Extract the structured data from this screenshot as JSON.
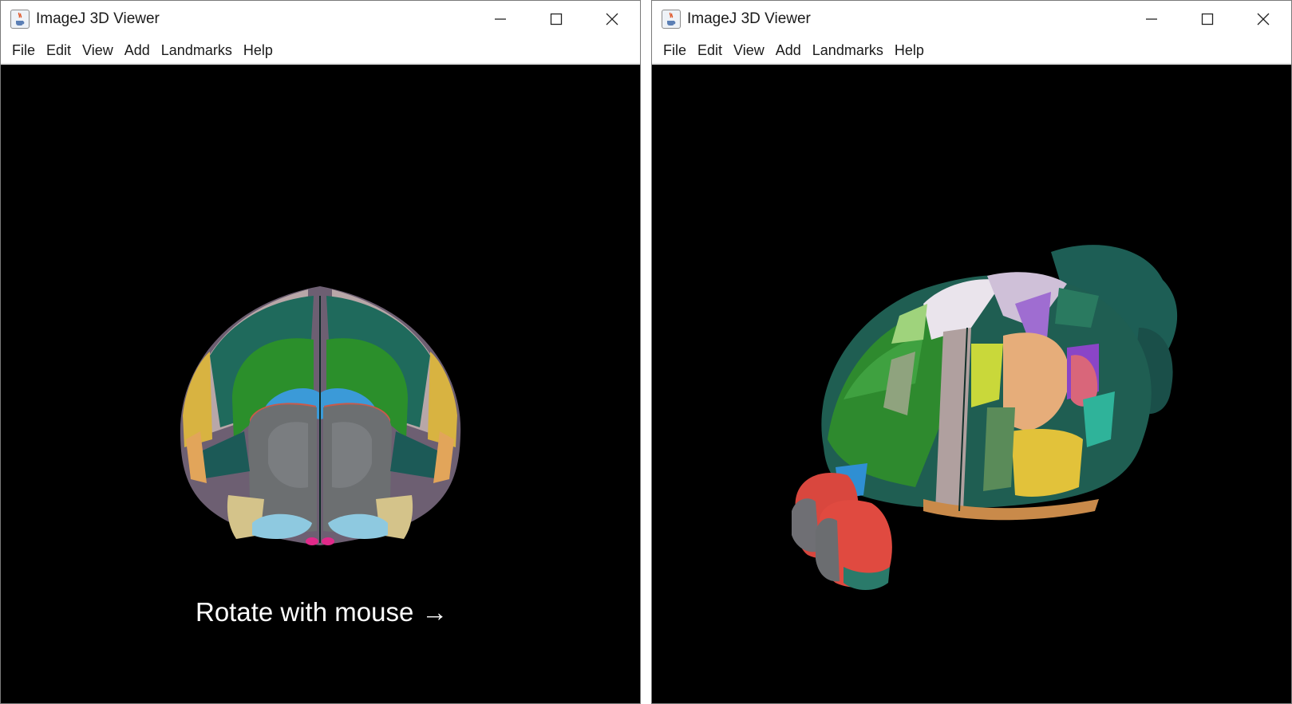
{
  "windows": [
    {
      "title": "ImageJ 3D Viewer",
      "menu": [
        "File",
        "Edit",
        "View",
        "Add",
        "Landmarks",
        "Help"
      ],
      "viewport_caption": "Rotate with mouse",
      "caption_arrow": "→"
    },
    {
      "title": "ImageJ 3D Viewer",
      "menu": [
        "File",
        "Edit",
        "View",
        "Add",
        "Landmarks",
        "Help"
      ]
    }
  ],
  "icons": {
    "app": "java-coffee-cup-icon",
    "minimize": "minimize-icon",
    "maximize": "maximize-icon",
    "close": "close-icon"
  },
  "colors": {
    "viewport_background": "#000000",
    "caption_text": "#ffffff"
  }
}
